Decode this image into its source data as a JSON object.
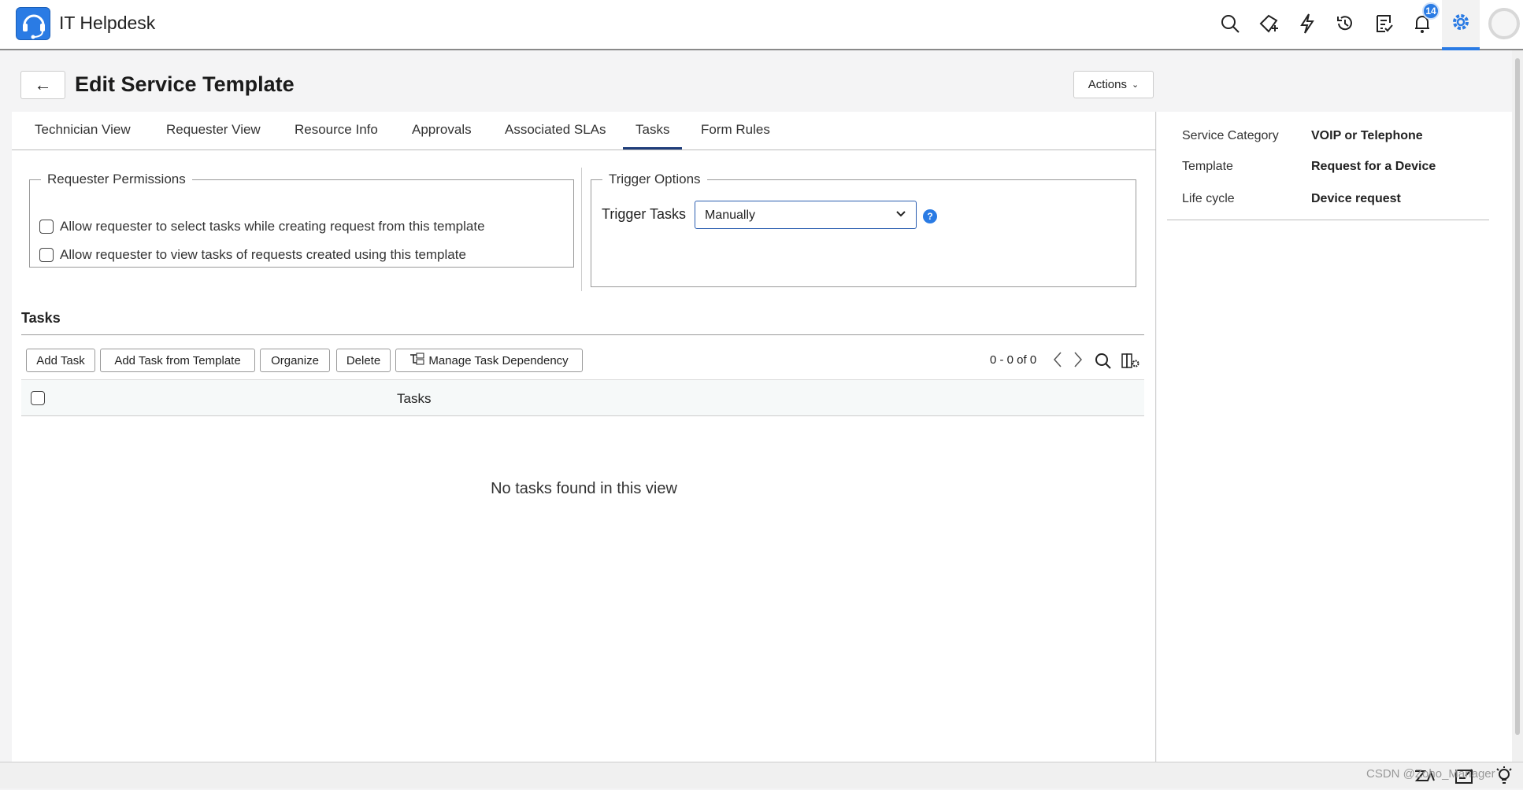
{
  "header": {
    "app_name": "IT Helpdesk",
    "notification_count": "14",
    "icons": [
      "search-icon",
      "new-ticket-icon",
      "lightning-icon",
      "history-icon",
      "task-icon",
      "bell-icon",
      "gear-icon",
      "avatar"
    ]
  },
  "page": {
    "title": "Edit Service Template",
    "actions_label": "Actions"
  },
  "tabs": [
    {
      "label": "Technician View"
    },
    {
      "label": "Requester View"
    },
    {
      "label": "Resource Info"
    },
    {
      "label": "Approvals"
    },
    {
      "label": "Associated SLAs"
    },
    {
      "label": "Tasks",
      "active": true
    },
    {
      "label": "Form Rules"
    }
  ],
  "requester_permissions": {
    "legend": "Requester Permissions",
    "options": [
      {
        "label": "Allow requester to select tasks while creating request from this template",
        "checked": false
      },
      {
        "label": "Allow requester to view tasks of requests created using this template",
        "checked": false
      }
    ]
  },
  "trigger_options": {
    "legend": "Trigger Options",
    "label": "Trigger Tasks",
    "value": "Manually"
  },
  "tasks": {
    "heading": "Tasks",
    "buttons": [
      "Add Task",
      "Add Task from Template",
      "Organize",
      "Delete",
      "Manage Task Dependency"
    ],
    "pagination": "0 - 0 of 0",
    "column": "Tasks",
    "empty": "No tasks found in this view"
  },
  "details": [
    {
      "label": "Service Category",
      "value": "VOIP or Telephone"
    },
    {
      "label": "Template",
      "value": "Request for a Device"
    },
    {
      "label": "Life cycle",
      "value": "Device request"
    }
  ],
  "watermark": "CSDN @Zoho_Manager",
  "colors": {
    "accent": "#2a7be4",
    "tab_underline": "#1f3d7a"
  }
}
